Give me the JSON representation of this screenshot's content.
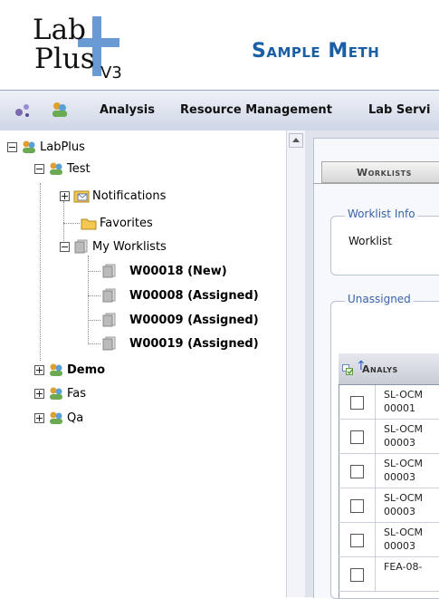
{
  "header": {
    "logo_text_top": "Lab",
    "logo_text_bottom": "Plus",
    "logo_version": "V3",
    "app_title": "Sample Meth"
  },
  "menubar": {
    "items": [
      "Analysis",
      "Resource Management",
      "Lab Servi"
    ]
  },
  "tree": {
    "root": "LabPlus",
    "test": "Test",
    "notifications": "Notifications",
    "favorites": "Favorites",
    "my_worklists": "My Worklists",
    "worklists": [
      "W00018 (New)",
      "W00008 (Assigned)",
      "W00009 (Assigned)",
      "W00019 (Assigned)"
    ],
    "demo": "Demo",
    "fas": "Fas",
    "qa": "Qa"
  },
  "content": {
    "tab_label": "Worklists",
    "fieldset1_legend": "Worklist Info",
    "worklist_label": "Worklist",
    "fieldset2_legend": "Unassigned",
    "table_header": "Analys",
    "rows": [
      [
        "SL-OCM",
        "00001"
      ],
      [
        "SL-OCM",
        "00003"
      ],
      [
        "SL-OCM",
        "00003"
      ],
      [
        "SL-OCM",
        "00003"
      ],
      [
        "SL-OCM",
        "00003"
      ],
      [
        "FEA-08-",
        ""
      ]
    ]
  },
  "colors": {
    "title_blue": "#1a5fa4",
    "legend_blue": "#3a63a8",
    "menubar_bg": "#cfd6e6"
  },
  "icons": {
    "menu": [
      "settings-cluster-icon",
      "user-group-icon"
    ],
    "tree_group": "user-group-icon",
    "notifications": "mail-folder-icon",
    "favorites": "folder-icon",
    "worklist": "document-stack-icon"
  }
}
